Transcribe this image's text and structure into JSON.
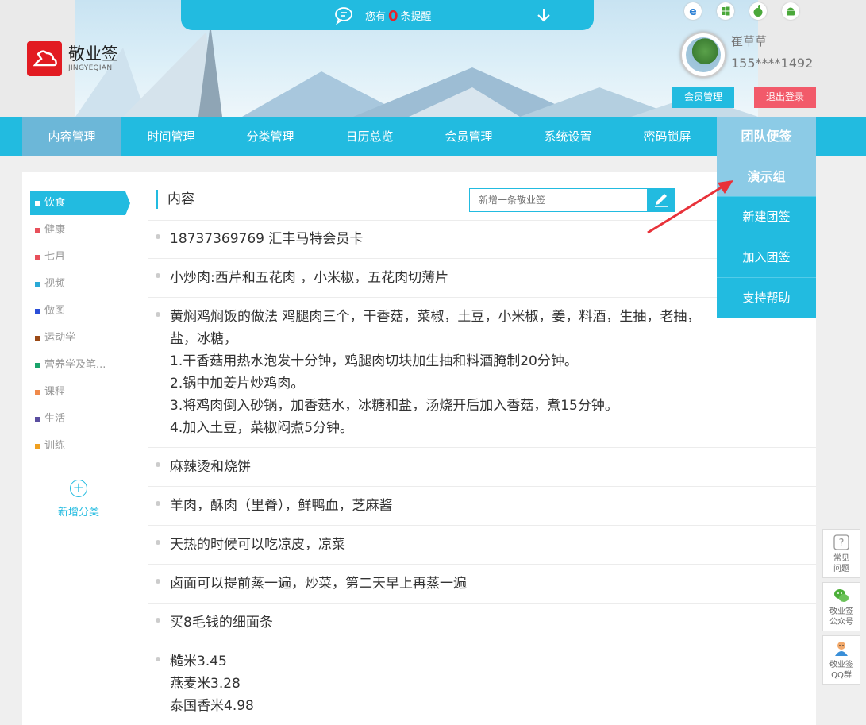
{
  "notice": {
    "prefix": "您有",
    "count": "0",
    "suffix": "条提醒"
  },
  "logo": {
    "name": "敬业签",
    "sub": "JINGYEQIAN"
  },
  "user": {
    "name": "崔草草",
    "phone": "155****1492",
    "member_btn": "会员管理",
    "logout_btn": "退出登录"
  },
  "nav": [
    "内容管理",
    "时间管理",
    "分类管理",
    "日历总览",
    "会员管理",
    "系统设置",
    "密码锁屏",
    "团队便签"
  ],
  "team_menu": [
    "演示组",
    "新建团签",
    "加入团签",
    "支持帮助"
  ],
  "categories": [
    {
      "label": "饮食",
      "color": "#1a9b3a"
    },
    {
      "label": "健康",
      "color": "#e8505b"
    },
    {
      "label": "七月",
      "color": "#e8505b"
    },
    {
      "label": "视频",
      "color": "#2aa9d6"
    },
    {
      "label": "做图",
      "color": "#2b4fd8"
    },
    {
      "label": "运动学",
      "color": "#9b4a16"
    },
    {
      "label": "营养学及笔...",
      "color": "#1aa36a"
    },
    {
      "label": "课程",
      "color": "#f08a4b"
    },
    {
      "label": "生活",
      "color": "#5a4ea0"
    },
    {
      "label": "训练",
      "color": "#f0a020"
    }
  ],
  "add_category": "新增分类",
  "content": {
    "title": "内容",
    "placeholder": "新增一条敬业签"
  },
  "notes": [
    [
      "18737369769 汇丰马特会员卡"
    ],
    [
      "小炒肉:西芹和五花肉 ，小米椒，五花肉切薄片"
    ],
    [
      "黄焖鸡焖饭的做法   鸡腿肉三个，干香菇，菜椒，土豆，小米椒，姜，料酒，生抽，老抽，",
      "盐，冰糖，",
      "1.干香菇用热水泡发十分钟，鸡腿肉切块加生抽和料酒腌制20分钟。",
      "2.锅中加姜片炒鸡肉。",
      "3.将鸡肉倒入砂锅，加香菇水，冰糖和盐，汤烧开后加入香菇，煮15分钟。",
      "4.加入土豆，菜椒闷煮5分钟。"
    ],
    [
      "麻辣烫和烧饼"
    ],
    [
      "羊肉，酥肉（里脊），鲜鸭血，芝麻酱"
    ],
    [
      "天热的时候可以吃凉皮，凉菜"
    ],
    [
      "卤面可以提前蒸一遍，炒菜，第二天早上再蒸一遍"
    ],
    [
      "买8毛钱的细面条"
    ],
    [
      "糙米3.45",
      "燕麦米3.28",
      "泰国香米4.98"
    ]
  ],
  "float": {
    "faq": [
      "常见",
      "问题"
    ],
    "wechat": [
      "敬业签",
      "公众号"
    ],
    "qq": [
      "敬业签",
      "QQ群"
    ]
  },
  "colors": {
    "accent": "#22bbe0",
    "logout": "#f25a6a",
    "logo": "#e21b22",
    "notice_count": "#e8222b"
  }
}
